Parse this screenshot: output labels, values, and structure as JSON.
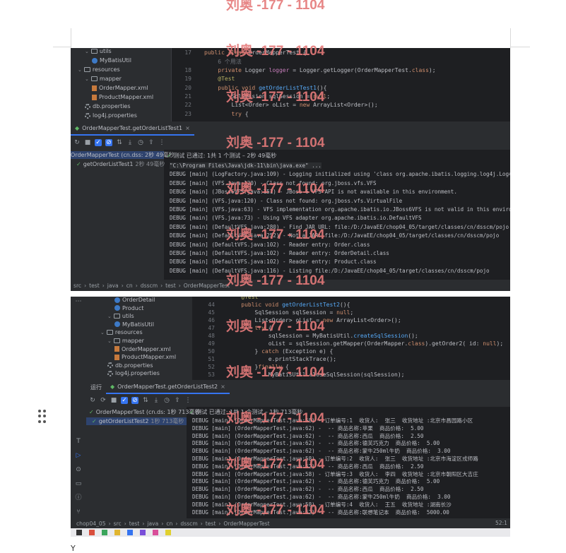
{
  "watermark": "刘奥 -177 - 1104",
  "top": {
    "tree": [
      {
        "label": "utils",
        "kind": "folder",
        "indent": 1
      },
      {
        "label": "MyBatisUtil",
        "kind": "class",
        "indent": 2
      },
      {
        "label": "resources",
        "kind": "folder",
        "indent": 0
      },
      {
        "label": "mapper",
        "kind": "folder",
        "indent": 1
      },
      {
        "label": "OrderMapper.xml",
        "kind": "xml",
        "indent": 2
      },
      {
        "label": "ProductMapper.xml",
        "kind": "xml",
        "indent": 2
      },
      {
        "label": "db.properties",
        "kind": "props",
        "indent": 1
      },
      {
        "label": "log4j.properties",
        "kind": "props",
        "indent": 1
      }
    ],
    "code": [
      {
        "ln": "17",
        "parts": [
          [
            "kw",
            "public class "
          ],
          [
            "plain",
            "OrderMapperTest {"
          ]
        ]
      },
      {
        "ln": "",
        "parts": [
          [
            "hint",
            "    6 个用法"
          ]
        ]
      },
      {
        "ln": "18",
        "parts": [
          [
            "kw",
            "    private "
          ],
          [
            "plain",
            "Logger "
          ],
          [
            "fld",
            "logger"
          ],
          [
            "plain",
            " = Logger.getLogger(OrderMapperTest."
          ],
          [
            "kw",
            "class"
          ],
          [
            "plain",
            ");"
          ]
        ]
      },
      {
        "ln": "19",
        "parts": [
          [
            "ann",
            "    @Test"
          ]
        ]
      },
      {
        "ln": "20",
        "parts": [
          [
            "kw",
            "    public void "
          ],
          [
            "fn",
            "getOrderListTest1"
          ],
          [
            "plain",
            "(){"
          ]
        ]
      },
      {
        "ln": "21",
        "parts": [
          [
            "plain",
            "        SqlSession sqlSession = "
          ],
          [
            "kw",
            "null"
          ],
          [
            "plain",
            ";"
          ]
        ]
      },
      {
        "ln": "22",
        "parts": [
          [
            "plain",
            "        List<Order> oList = "
          ],
          [
            "kw",
            "new "
          ],
          [
            "plain",
            "ArrayList<Order>();"
          ]
        ]
      },
      {
        "ln": "23",
        "parts": [
          [
            "kw",
            "        try "
          ],
          [
            "plain",
            "{"
          ]
        ]
      }
    ],
    "run_tab": "OrderMapperTest.getOrderListTest1",
    "test_tree": [
      {
        "label": "OrderMapperTest (cn.dss: 2秒 49毫秒",
        "sel": true
      },
      {
        "label": "getOrderListTest1",
        "time": "2秒 49毫秒",
        "sel": false
      }
    ],
    "status": "测试 已通过: 1共 1 个测试 – 2秒 49毫秒",
    "console": [
      "\"C:\\Program Files\\Java\\jdk-11\\bin\\java.exe\" ...",
      "DEBUG [main] (LogFactory.java:109) - Logging initialized using 'class org.apache.ibatis.logging.log4j.Log4jI",
      "DEBUG [main] (VFS.java:120) - Class not found: org.jboss.vfs.VFS",
      "DEBUG [main] (JBoss6VFS.java:151) - JBoss 6 VFS API is not available in this environment.",
      "DEBUG [main] (VFS.java:120) - Class not found: org.jboss.vfs.VirtualFile",
      "DEBUG [main] (VFS.java:63) - VFS implementation org.apache.ibatis.io.JBoss6VFS is not valid in this environm",
      "DEBUG [main] (VFS.java:73) - Using VFS adapter org.apache.ibatis.io.DefaultVFS",
      "DEBUG [main] (DefaultVFS.java:280) - Find JAR URL: file:/D:/JavaEE/chop04_05/target/classes/cn/dsscm/pojo",
      "DEBUG [main] (DefaultVFS.java:252) - Not a JAR: file:/D:/JavaEE/chop04_05/target/classes/cn/dsscm/pojo",
      "DEBUG [main] (DefaultVFS.java:102) - Reader entry: Order.class",
      "DEBUG [main] (DefaultVFS.java:102) - Reader entry: OrderDetail.class",
      "DEBUG [main] (DefaultVFS.java:102) - Reader entry: Product.class",
      "DEBUG [main] (DefaultVFS.java:116) - Listing file:/D:/JavaEE/chop04_05/target/classes/cn/dsscm/pojo"
    ],
    "breadcrumb": [
      "src",
      "test",
      "java",
      "cn",
      "dsscm",
      "test",
      "OrderMapperTest"
    ]
  },
  "bottom": {
    "tree": [
      {
        "label": "OrderDetail",
        "kind": "class",
        "indent": 3
      },
      {
        "label": "Product",
        "kind": "class",
        "indent": 3
      },
      {
        "label": "utils",
        "kind": "folder",
        "indent": 2
      },
      {
        "label": "MyBatisUtil",
        "kind": "class",
        "indent": 3
      },
      {
        "label": "resources",
        "kind": "folder",
        "indent": 1
      },
      {
        "label": "mapper",
        "kind": "folder",
        "indent": 2
      },
      {
        "label": "OrderMapper.xml",
        "kind": "xml",
        "indent": 3
      },
      {
        "label": "ProductMapper.xml",
        "kind": "xml",
        "indent": 3
      },
      {
        "label": "db.properties",
        "kind": "props",
        "indent": 2
      },
      {
        "label": "log4j.properties",
        "kind": "props",
        "indent": 2
      }
    ],
    "code": [
      {
        "ln": "",
        "parts": [
          [
            "ann",
            "    @Test"
          ]
        ]
      },
      {
        "ln": "44",
        "parts": [
          [
            "kw",
            "    public void "
          ],
          [
            "fn",
            "getOrderListTest2"
          ],
          [
            "plain",
            "(){"
          ]
        ]
      },
      {
        "ln": "45",
        "parts": [
          [
            "plain",
            "        SqlSession sqlSession = "
          ],
          [
            "kw",
            "null"
          ],
          [
            "plain",
            ";"
          ]
        ]
      },
      {
        "ln": "46",
        "parts": [
          [
            "plain",
            "        List<Order> oList = "
          ],
          [
            "kw",
            "new "
          ],
          [
            "plain",
            "ArrayList<Order>();"
          ]
        ]
      },
      {
        "ln": "47",
        "parts": [
          [
            "kw",
            "        try "
          ],
          [
            "plain",
            "{"
          ]
        ]
      },
      {
        "ln": "48",
        "parts": [
          [
            "plain",
            "            sqlSession = MyBatisUtil."
          ],
          [
            "fn",
            "createSqlSession"
          ],
          [
            "plain",
            "();"
          ]
        ]
      },
      {
        "ln": "49",
        "parts": [
          [
            "plain",
            "            oList = sqlSession.getMapper(OrderMapper."
          ],
          [
            "kw",
            "class"
          ],
          [
            "plain",
            ").getOrder2( id: "
          ],
          [
            "kw",
            "null"
          ],
          [
            "plain",
            ");"
          ]
        ]
      },
      {
        "ln": "50",
        "parts": [
          [
            "plain",
            "        } "
          ],
          [
            "kw",
            "catch "
          ],
          [
            "plain",
            "(Exception e) {"
          ]
        ]
      },
      {
        "ln": "51",
        "parts": [
          [
            "plain",
            "            e.printStackTrace();"
          ]
        ]
      },
      {
        "ln": "52",
        "parts": [
          [
            "plain",
            "        }"
          ],
          [
            "kw",
            "finally "
          ],
          [
            "plain",
            "{"
          ]
        ]
      },
      {
        "ln": "53",
        "parts": [
          [
            "plain",
            "            MyBatisUtil.closeSqlSession(sqlSession);"
          ]
        ]
      }
    ],
    "run_label": "运行",
    "run_tab": "OrderMapperTest.getOrderListTest2",
    "test_tree": [
      {
        "label": "OrderMapperTest (cn.ds: 1秒 713毫秒",
        "sel": false
      },
      {
        "label": "getOrderListTest2",
        "time": "1秒 713毫秒",
        "sel": true
      }
    ],
    "status": "测试 已通过: 1共 1 个测试 – 1秒 713毫秒",
    "console": [
      "DEBUG [main] (OrderMapperTest.java:58) - 订单编号:1  收货人:  张三  收货地址 :北京市昌园路小区",
      "DEBUG [main] (OrderMapperTest.java:62) -  -- 商品名称:苹果  商品价格:  5.00",
      "DEBUG [main] (OrderMapperTest.java:62) -  -- 商品名称:西瓜  商品价格:  2.50",
      "DEBUG [main] (OrderMapperTest.java:62) -  -- 商品名称:德芙巧克力  商品价格:  5.00",
      "DEBUG [main] (OrderMapperTest.java:62) -  -- 商品名称:蒙牛250ml牛奶  商品价格:  3.00",
      "DEBUG [main] (OrderMapperTest.java:58) - 订单编号:2  收货人:  张三  收货地址 :北京市海淀区戎师路",
      "DEBUG [main] (OrderMapperTest.java:62) -  -- 商品名称:西瓜  商品价格:  2.50",
      "DEBUG [main] (OrderMapperTest.java:58) - 订单编号:3  收货人:  李四  收货地址 :北京市朝阳区大吉庄",
      "DEBUG [main] (OrderMapperTest.java:62) -  -- 商品名称:德芙巧克力  商品价格:  5.00",
      "DEBUG [main] (OrderMapperTest.java:62) -  -- 商品名称:西瓜  商品价格:  2.50",
      "DEBUG [main] (OrderMapperTest.java:62) -  -- 商品名称:蒙牛250ml牛奶  商品价格:  3.00",
      "DEBUG [main] (OrderMapperTest.java:58) - 订单编号:4  收货人:  王五  收货地址 :湖南长沙",
      "DEBUG [main] (OrderMapperTest.java:62) -  -- 商品名称:联想笔记本  商品价格:  5000.00"
    ],
    "breadcrumb": [
      "chop04_05",
      "src",
      "test",
      "java",
      "cn",
      "dsscm",
      "test",
      "OrderMapperTest"
    ],
    "caret": "52:1"
  },
  "footer_char": "Y"
}
